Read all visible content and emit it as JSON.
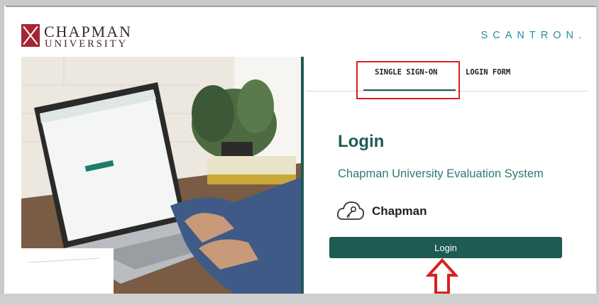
{
  "header": {
    "university_line1": "CHAPMAN",
    "university_line2": "UNIVERSITY",
    "partner": "SCANTRON."
  },
  "tabs": [
    {
      "label": "SINGLE SIGN-ON",
      "active": true
    },
    {
      "label": "LOGIN FORM",
      "active": false
    }
  ],
  "login": {
    "title": "Login",
    "subtitle": "Chapman University Evaluation System",
    "provider_label": "Chapman",
    "provider_icon": "cloud-key-icon",
    "button_label": "Login"
  },
  "colors": {
    "brand": "#1e5b55",
    "scantron": "#1f8fa5",
    "chapman": "#a52535",
    "annotation": "#d8221f"
  },
  "annotations": {
    "highlight": "box around SINGLE SIGN-ON tab",
    "arrow": "red up-arrow pointing at Login button"
  }
}
